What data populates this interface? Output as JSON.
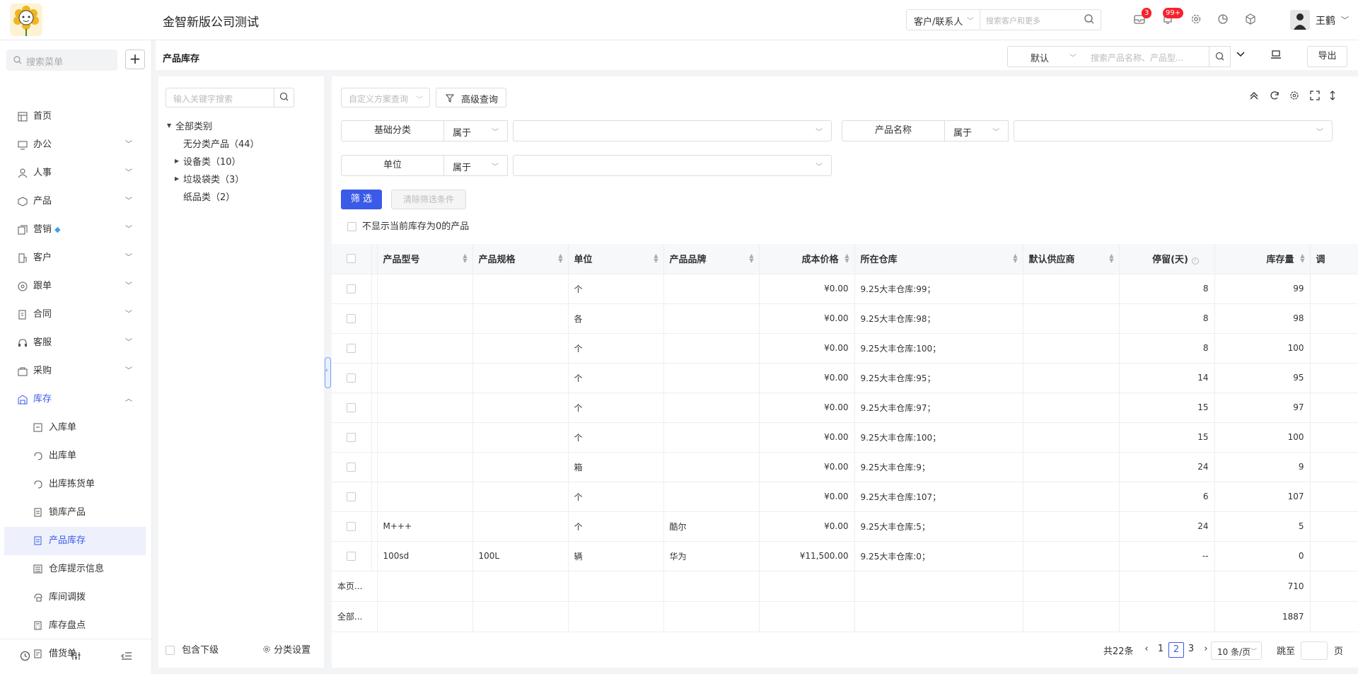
{
  "header": {
    "company": "金智新版公司测试",
    "search_type": "客户/联系人",
    "search_placeholder": "搜索客户和更多",
    "msg_badge": "3",
    "notify_badge": "99+",
    "user_name": "王鹤"
  },
  "sidebar": {
    "search_placeholder": "搜索菜单",
    "add_label": "+",
    "items": [
      {
        "label": "首页"
      },
      {
        "label": "办公"
      },
      {
        "label": "人事"
      },
      {
        "label": "产品"
      },
      {
        "label": "营销"
      },
      {
        "label": "客户"
      },
      {
        "label": "跟单"
      },
      {
        "label": "合同"
      },
      {
        "label": "客服"
      },
      {
        "label": "采购"
      },
      {
        "label": "库存"
      }
    ],
    "sub_items": [
      {
        "label": "入库单"
      },
      {
        "label": "出库单"
      },
      {
        "label": "出库拣货单"
      },
      {
        "label": "锁库产品"
      },
      {
        "label": "产品库存"
      },
      {
        "label": "仓库提示信息"
      },
      {
        "label": "库间调拨"
      },
      {
        "label": "库存盘点"
      },
      {
        "label": "借货单"
      }
    ]
  },
  "page": {
    "title": "产品库存",
    "default_view": "默认",
    "search_placeholder": "搜索产品名称、产品型...",
    "export_label": "导出"
  },
  "tree": {
    "search_placeholder": "输入关键字搜索",
    "root": "全部类别",
    "nodes": [
      {
        "label": "无分类产品（44）"
      },
      {
        "label": "设备类（10）"
      },
      {
        "label": "垃圾袋类（3）"
      },
      {
        "label": "纸品类（2）"
      }
    ],
    "include_sub": "包含下级",
    "settings": "分类设置"
  },
  "filters": {
    "custom_placeholder": "自定义方案查询",
    "advanced": "高级查询",
    "f1_label": "基础分类",
    "f1_op": "属于",
    "f2_label": "产品名称",
    "f2_op": "属于",
    "f3_label": "单位",
    "f3_op": "属于",
    "filter_btn": "筛 选",
    "clear_btn": "清除筛选条件",
    "nozero": "不显示当前库存为0的产品"
  },
  "table": {
    "headers": [
      "产品型号",
      "产品规格",
      "单位",
      "产品品牌",
      "成本价格",
      "所在仓库",
      "默认供应商",
      "停留(天)",
      "库存量",
      "调"
    ],
    "rows": [
      {
        "model": "",
        "spec": "",
        "unit": "个",
        "brand": "",
        "cost": "¥0.00",
        "wh": "9.25大丰仓库:99；",
        "supplier": "",
        "stay": "8",
        "qty": "99"
      },
      {
        "model": "",
        "spec": "",
        "unit": "各",
        "brand": "",
        "cost": "¥0.00",
        "wh": "9.25大丰仓库:98；",
        "supplier": "",
        "stay": "8",
        "qty": "98"
      },
      {
        "model": "",
        "spec": "",
        "unit": "个",
        "brand": "",
        "cost": "¥0.00",
        "wh": "9.25大丰仓库:100；",
        "supplier": "",
        "stay": "8",
        "qty": "100"
      },
      {
        "model": "",
        "spec": "",
        "unit": "个",
        "brand": "",
        "cost": "¥0.00",
        "wh": "9.25大丰仓库:95；",
        "supplier": "",
        "stay": "14",
        "qty": "95"
      },
      {
        "model": "",
        "spec": "",
        "unit": "个",
        "brand": "",
        "cost": "¥0.00",
        "wh": "9.25大丰仓库:97；",
        "supplier": "",
        "stay": "15",
        "qty": "97"
      },
      {
        "model": "",
        "spec": "",
        "unit": "个",
        "brand": "",
        "cost": "¥0.00",
        "wh": "9.25大丰仓库:100；",
        "supplier": "",
        "stay": "15",
        "qty": "100"
      },
      {
        "model": "",
        "spec": "",
        "unit": "箱",
        "brand": "",
        "cost": "¥0.00",
        "wh": "9.25大丰仓库:9；",
        "supplier": "",
        "stay": "24",
        "qty": "9"
      },
      {
        "model": "",
        "spec": "",
        "unit": "个",
        "brand": "",
        "cost": "¥0.00",
        "wh": "9.25大丰仓库:107；",
        "supplier": "",
        "stay": "6",
        "qty": "107"
      },
      {
        "model": "M+++",
        "spec": "",
        "unit": "个",
        "brand": "酷尔",
        "cost": "¥0.00",
        "wh": "9.25大丰仓库:5；",
        "supplier": "",
        "stay": "24",
        "qty": "5"
      },
      {
        "model": "100sd",
        "spec": "100L",
        "unit": "辆",
        "brand": "华为",
        "cost": "¥11,500.00",
        "wh": "9.25大丰仓库:0；",
        "supplier": "",
        "stay": "--",
        "qty": "0"
      }
    ],
    "sum_page_label": "本页...",
    "sum_page_qty": "710",
    "sum_all_label": "全部...",
    "sum_all_qty": "1887"
  },
  "pagination": {
    "total": "共22条",
    "pages": [
      "1",
      "2",
      "3"
    ],
    "current": "2",
    "size": "10 条/页",
    "jump": "跳至",
    "page_unit": "页"
  }
}
